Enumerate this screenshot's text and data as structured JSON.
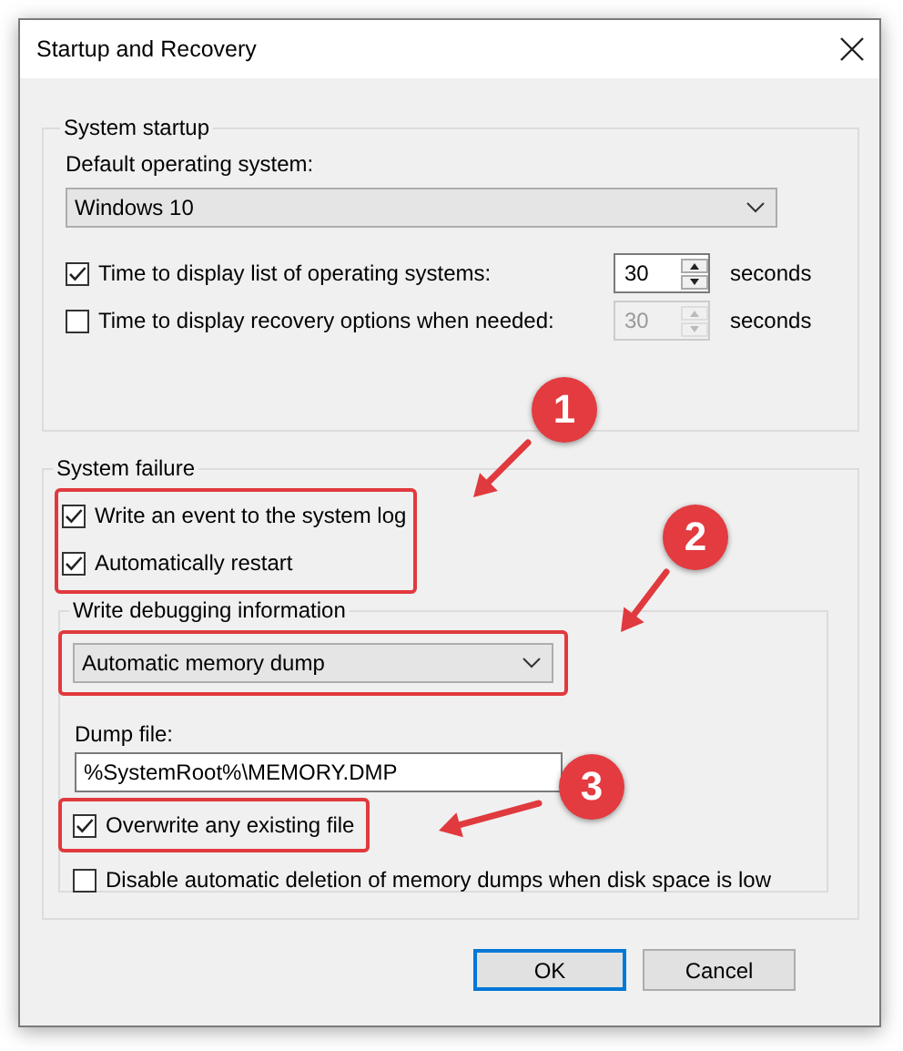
{
  "window": {
    "title": "Startup and Recovery"
  },
  "system_startup": {
    "title": "System startup",
    "default_os_label": "Default operating system:",
    "default_os": "Windows 10",
    "timers": [
      {
        "label": "Time to display list of operating systems:",
        "checked": true,
        "value": "30",
        "disabled": false,
        "unit": "seconds"
      },
      {
        "label": "Time to display recovery options when needed:",
        "checked": false,
        "value": "30",
        "disabled": true,
        "unit": "seconds"
      }
    ]
  },
  "system_failure": {
    "title": "System failure",
    "options_highlighted": true,
    "options": [
      {
        "label": "Write an event to the system log",
        "checked": true
      },
      {
        "label": "Automatically restart",
        "checked": true
      }
    ],
    "debugging": {
      "title": "Write debugging information",
      "type": "Automatic memory dump",
      "type_highlighted": true,
      "dump_file_label": "Dump file:",
      "dump_file": "%SystemRoot%\\MEMORY.DMP",
      "options": [
        {
          "label": "Overwrite any existing file",
          "checked": true,
          "highlighted": true
        },
        {
          "label": "Disable automatic deletion of memory dumps when disk space is low",
          "checked": false,
          "highlighted": false
        }
      ]
    }
  },
  "buttons": [
    {
      "label": "OK",
      "default": true
    },
    {
      "label": "Cancel",
      "default": false
    }
  ],
  "annotations": [
    {
      "number": "1"
    },
    {
      "number": "2"
    },
    {
      "number": "3"
    }
  ]
}
